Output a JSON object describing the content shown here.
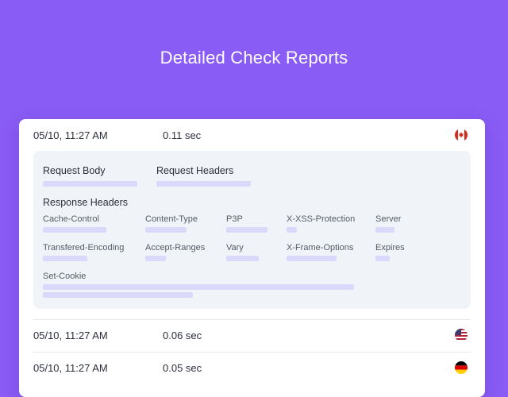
{
  "header": {
    "title": "Detailed Check Reports"
  },
  "checks": [
    {
      "time": "05/10, 11:27  AM",
      "duration": "0.11 sec",
      "flag_icon": "canada-flag-icon"
    },
    {
      "time": "05/10, 11:27  AM",
      "duration": "0.06 sec",
      "flag_icon": "usa-flag-icon"
    },
    {
      "time": "05/10, 11:27  AM",
      "duration": "0.05 sec",
      "flag_icon": "germany-flag-icon"
    }
  ],
  "detail": {
    "request_body_label": "Request Body",
    "request_headers_label": "Request Headers",
    "response_headers_label": "Response Headers",
    "headers": [
      "Cache-Control",
      "Content-Type",
      "P3P",
      "X-XSS-Protection",
      "Server",
      "Transfered-Encoding",
      "Accept-Ranges",
      "Vary",
      "X-Frame-Options",
      "Expires",
      "Set-Cookie"
    ]
  },
  "colors": {
    "background": "#8a5cf6",
    "placeholder_bar": "#dcd8fb",
    "detail_panel": "#f0f3f7"
  }
}
